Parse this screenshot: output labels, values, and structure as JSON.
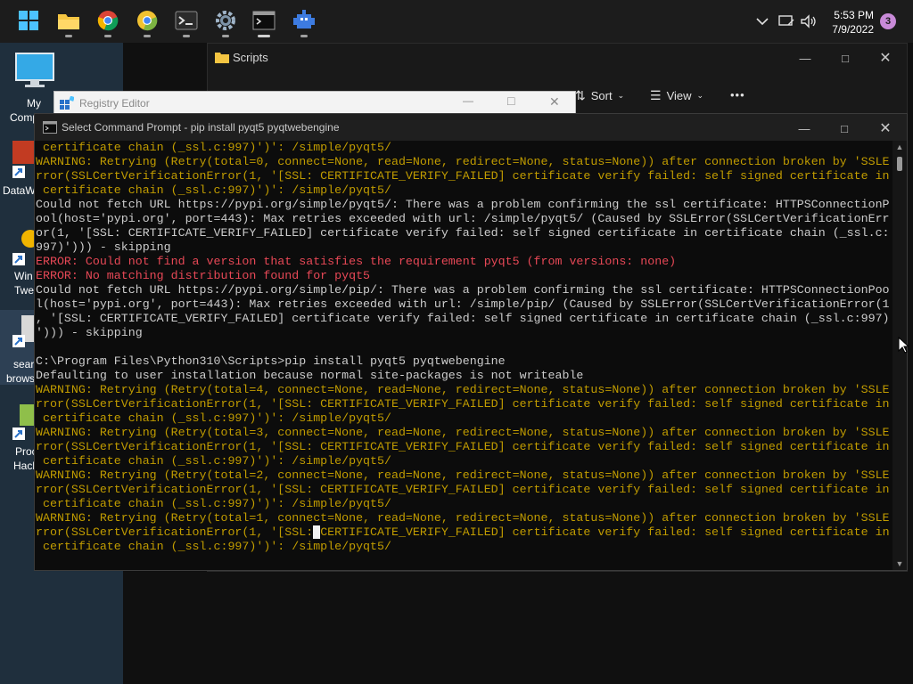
{
  "taskbar": {
    "apps": [
      "start-button",
      "file-explorer",
      "chrome",
      "chrome-canary",
      "terminal",
      "settings",
      "command-prompt",
      "app-icon"
    ],
    "clock_time": "5:53 PM",
    "clock_date": "7/9/2022",
    "notification_count": "3"
  },
  "desktop": {
    "labels": {
      "my_computer_1": "My",
      "my_computer_2": "Comp",
      "datawrapper": "DataW",
      "windows_1": "Win",
      "windows_2": "Twe",
      "search_1": "sear",
      "search_2": "brows",
      "process_1": "Proc",
      "process_2": "Hack"
    }
  },
  "explorer": {
    "title": "Scripts",
    "sort_label": "Sort",
    "view_label": "View",
    "more_label": "•••"
  },
  "regedit": {
    "title": "Registry Editor"
  },
  "cmd": {
    "title": "Select Command Prompt - pip  install pyqt5 pyqtwebengine",
    "lines": [
      {
        "t": "w",
        "s": " certificate chain (_ssl.c:997)')': /simple/pyqt5/"
      },
      {
        "t": "w",
        "s": "WARNING: Retrying (Retry(total=0, connect=None, read=None, redirect=None, status=None)) after connection broken by 'SSLE"
      },
      {
        "t": "w",
        "s": "rror(SSLCertVerificationError(1, '[SSL: CERTIFICATE_VERIFY_FAILED] certificate verify failed: self signed certificate in"
      },
      {
        "t": "w",
        "s": " certificate chain (_ssl.c:997)')': /simple/pyqt5/"
      },
      {
        "t": "d",
        "s": "Could not fetch URL https://pypi.org/simple/pyqt5/: There was a problem confirming the ssl certificate: HTTPSConnectionP"
      },
      {
        "t": "d",
        "s": "ool(host='pypi.org', port=443): Max retries exceeded with url: /simple/pyqt5/ (Caused by SSLError(SSLCertVerificationErr"
      },
      {
        "t": "d",
        "s": "or(1, '[SSL: CERTIFICATE_VERIFY_FAILED] certificate verify failed: self signed certificate in certificate chain (_ssl.c:"
      },
      {
        "t": "d",
        "s": "997)'))) - skipping"
      },
      {
        "t": "e",
        "s": "ERROR: Could not find a version that satisfies the requirement pyqt5 (from versions: none)"
      },
      {
        "t": "e",
        "s": "ERROR: No matching distribution found for pyqt5"
      },
      {
        "t": "d",
        "s": "Could not fetch URL https://pypi.org/simple/pip/: There was a problem confirming the ssl certificate: HTTPSConnectionPoo"
      },
      {
        "t": "d",
        "s": "l(host='pypi.org', port=443): Max retries exceeded with url: /simple/pip/ (Caused by SSLError(SSLCertVerificationError(1"
      },
      {
        "t": "d",
        "s": ", '[SSL: CERTIFICATE_VERIFY_FAILED] certificate verify failed: self signed certificate in certificate chain (_ssl.c:997)"
      },
      {
        "t": "d",
        "s": "'))) - skipping"
      },
      {
        "t": "d",
        "s": ""
      },
      {
        "t": "d",
        "s": "C:\\Program Files\\Python310\\Scripts>pip install pyqt5 pyqtwebengine"
      },
      {
        "t": "d",
        "s": "Defaulting to user installation because normal site-packages is not writeable"
      },
      {
        "t": "w",
        "s": "WARNING: Retrying (Retry(total=4, connect=None, read=None, redirect=None, status=None)) after connection broken by 'SSLE"
      },
      {
        "t": "w",
        "s": "rror(SSLCertVerificationError(1, '[SSL: CERTIFICATE_VERIFY_FAILED] certificate verify failed: self signed certificate in"
      },
      {
        "t": "w",
        "s": " certificate chain (_ssl.c:997)')': /simple/pyqt5/"
      },
      {
        "t": "w",
        "s": "WARNING: Retrying (Retry(total=3, connect=None, read=None, redirect=None, status=None)) after connection broken by 'SSLE"
      },
      {
        "t": "w",
        "s": "rror(SSLCertVerificationError(1, '[SSL: CERTIFICATE_VERIFY_FAILED] certificate verify failed: self signed certificate in"
      },
      {
        "t": "w",
        "s": " certificate chain (_ssl.c:997)')': /simple/pyqt5/"
      },
      {
        "t": "w",
        "s": "WARNING: Retrying (Retry(total=2, connect=None, read=None, redirect=None, status=None)) after connection broken by 'SSLE"
      },
      {
        "t": "w",
        "s": "rror(SSLCertVerificationError(1, '[SSL: CERTIFICATE_VERIFY_FAILED] certificate verify failed: self signed certificate in"
      },
      {
        "t": "w",
        "s": " certificate chain (_ssl.c:997)')': /simple/pyqt5/"
      },
      {
        "t": "w",
        "s": "WARNING: Retrying (Retry(total=1, connect=None, read=None, redirect=None, status=None)) after connection broken by 'SSLE"
      },
      {
        "t": "w",
        "s": "rror(SSLCertVerificationError(1, '[SSL: CERTIFICATE_VERIFY_FAILED] certificate verify failed: self signed certificate in",
        "cursor_after": "rror(SSLCertVerificationError(1, '[SSL:"
      },
      {
        "t": "w",
        "s": " certificate chain (_ssl.c:997)')': /simple/pyqt5/"
      }
    ]
  },
  "colors": {
    "warning": "#c19c00",
    "error": "#e74856",
    "default": "#cccccc"
  }
}
